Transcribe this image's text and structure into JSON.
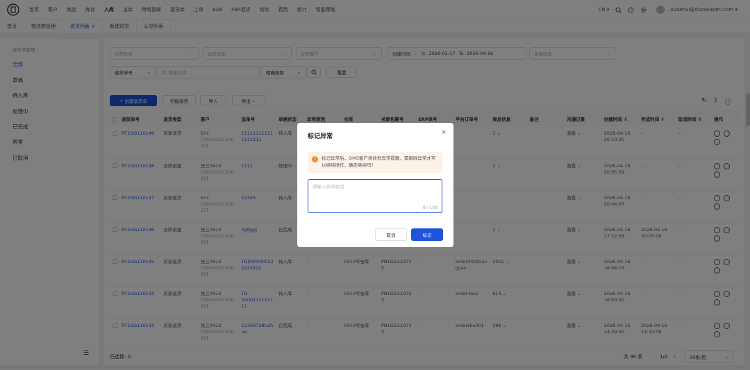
{
  "nav": {
    "items": [
      "首页",
      "客户",
      "商品",
      "库存",
      "入库",
      "出库",
      "跨境直邮",
      "提货库",
      "工单",
      "B2B",
      "FBA退货",
      "物流",
      "费用",
      "统计",
      "智能策略"
    ],
    "lang": "CN",
    "user": "xudehui@dianxiaomi.com"
  },
  "tabs": [
    "首页",
    "物流商管理",
    "退货列表",
    "新建退货",
    "认领列表"
  ],
  "sidebar": {
    "title": "退货单管理",
    "items": [
      "全部",
      "草稿",
      "待入库",
      "处理中",
      "已完成",
      "异常",
      "已取消"
    ]
  },
  "filters": {
    "warehouse": "全部仓库",
    "return_type": "退货类型",
    "customer": "全部客户",
    "time_label": "创建时间",
    "date_from": "2026-01-17",
    "date_to_label": "To",
    "date_to": "2026-04-16",
    "status": "单据状态",
    "search_field": "退货单号",
    "search_placeholder": "搜索内容",
    "search_mode": "精确搜索",
    "reset": "重置"
  },
  "toolbar": {
    "create": "创建退货单",
    "scan": "扫描退货",
    "import": "导入",
    "export": "导出"
  },
  "table": {
    "headers": [
      "退货单号",
      "退货类型",
      "客户",
      "运单号",
      "单据状态",
      "异常原因",
      "仓库",
      "关联包裹号",
      "ERP单号",
      "平台订单号",
      "商品信息",
      "备注",
      "沟通记录",
      "创建时间",
      "完成时间",
      "取消时间",
      "操作"
    ],
    "rows": [
      {
        "no": "RT1GG110149",
        "type": "买家退货",
        "cust": "Eric",
        "cust_sub": "[CNO1GG1100 27]",
        "waybill": "11111111111 1111111",
        "status": "待入库",
        "reason": "",
        "wh": "",
        "pkg": "",
        "erp": "",
        "order": "",
        "goods": "1",
        "note": "",
        "comm": "查看",
        "created": "2026-04-16 20:10:35",
        "done": "–",
        "cancel": "–"
      },
      {
        "no": "RT1GG110148",
        "type": "仓库创建",
        "cust": "张三0413",
        "cust_sub": "[CNO1GG1100 29]",
        "waybill": "1111",
        "status": "处理中",
        "reason": "",
        "wh": "",
        "pkg": "",
        "erp": "",
        "order": "",
        "goods": "1",
        "note": "",
        "comm": "查看",
        "created": "2026-04-16 20:05:59",
        "done": "–",
        "cancel": "–"
      },
      {
        "no": "RT1GG110147",
        "type": "买家退货",
        "cust": "Eric",
        "cust_sub": "[CNO1GG1100 27]",
        "waybill": "12345",
        "status": "待入库",
        "reason": "",
        "wh": "",
        "pkg": "",
        "erp": "",
        "order": "",
        "goods": "",
        "note": "",
        "comm": "查看",
        "created": "2026-04-16 20:04:07",
        "done": "–",
        "cancel": "–"
      },
      {
        "no": "RT1GG110146",
        "type": "仓库创建",
        "cust": "张三0413",
        "cust_sub": "[CNO1GG1100 29]",
        "waybill": "hgfjgjg",
        "status": "已完成",
        "reason": "",
        "wh": "",
        "pkg": "",
        "erp": "",
        "order": "",
        "goods": "1",
        "note": "",
        "comm": "查看",
        "created": "2026-04-16 17:22:28",
        "done": "2026-04-16 20:05:06",
        "cancel": "–"
      },
      {
        "no": "RT1GG110145",
        "type": "买家退货",
        "cust": "张三0413",
        "cust_sub": "[CNO1GG1100 29]",
        "waybill": "TD000000022 2222222",
        "status": "待入库",
        "reason": "–",
        "wh": "0413号仓库",
        "pkg": "PN1GG11073 5",
        "erp": "–",
        "order": "order002zhan gsan",
        "goods": "2002",
        "note": "",
        "comm": "查看",
        "created": "2026-04-16 16:04:16",
        "done": "–",
        "cancel": "–"
      },
      {
        "no": "RT1GG110144",
        "type": "买家退货",
        "cust": "张三0413",
        "cust_sub": "[CNO1GG1100 29]",
        "waybill": "TD-00001111111 11",
        "status": "待入库",
        "reason": "–",
        "wh": "0413号仓库",
        "pkg": "PN1GG11075 3",
        "erp": "–",
        "order": "order-boci",
        "goods": "614",
        "note": "",
        "comm": "查看",
        "created": "2026-04-16 16:03:20",
        "done": "–",
        "cancel": "–"
      },
      {
        "no": "RT1GG110143",
        "type": "买家退货",
        "cust": "张三0413",
        "cust_sub": "[CNO1GG1100 29]",
        "waybill": "12356738tuih uo",
        "status": "已完成",
        "reason": "–",
        "wh": "0413号仓库",
        "pkg": "PN1GG11073 3",
        "erp": "–",
        "order": "ordersku001",
        "goods": "398",
        "note": "",
        "comm": "查看",
        "created": "2026-04-16 14:39:40",
        "done": "2026-04-16 14:43:08",
        "cancel": "–"
      }
    ]
  },
  "footer": {
    "selected": "已选择: 0",
    "total": "共 90 条",
    "page": "1/2",
    "page_size": "50条/页"
  },
  "modal": {
    "title": "标记异常",
    "warning": "标记异常后，OMS客户将收到异常提醒，需解除异常才可以继续操作，确定继续吗?",
    "placeholder": "请输入异常原因",
    "counter": "0 / 100",
    "cancel": "取消",
    "confirm": "标记"
  },
  "colors": {
    "primary": "#1d54d8",
    "warning": "#f08b2e"
  }
}
